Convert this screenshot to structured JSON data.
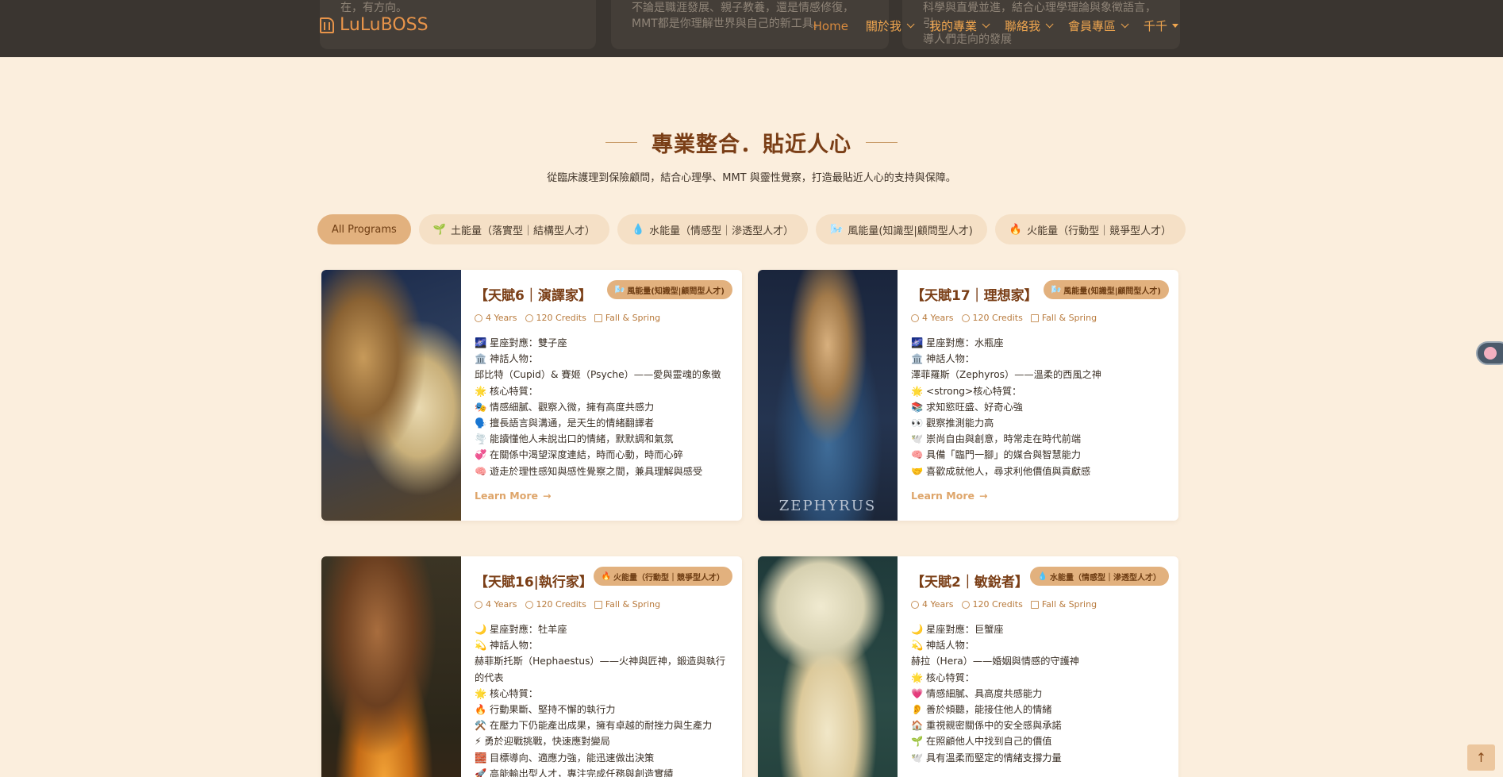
{
  "header": {
    "logo_text": "LuLuBOSS",
    "ghost_texts": [
      "在，有方向。",
      "不論是職涯發展、親子教養，還是情感修復，\nMMT都是你理解世界與自己的新工具。",
      "科學與直覺並進，結合心理學理論與象徵語言，引\n導人們走向的發展"
    ],
    "nav": [
      {
        "label": "Home"
      },
      {
        "label": "關於我"
      },
      {
        "label": "我的專業"
      },
      {
        "label": "聯絡我"
      },
      {
        "label": "會員專區"
      },
      {
        "label": "千千"
      }
    ]
  },
  "section": {
    "title": "專業整合．貼近人心",
    "subtitle": "從臨床護理到保險顧問，結合心理學、MMT 與靈性覺察，打造最貼近人心的支持與保障。"
  },
  "filters": [
    {
      "label": "All Programs",
      "icon": ""
    },
    {
      "label": "土能量（落實型｜結構型人才）",
      "icon": "🌱"
    },
    {
      "label": "水能量（情感型｜滲透型人才）",
      "icon": "💧"
    },
    {
      "label": "風能量(知識型|顧問型人才)",
      "icon": "🌬️"
    },
    {
      "label": "火能量（行動型｜競爭型人才）",
      "icon": "🔥"
    }
  ],
  "meta": {
    "years": "4 Years",
    "credits": "120 Credits",
    "term": "Fall & Spring"
  },
  "learn_more": "Learn More",
  "cards": [
    {
      "title": "【天賦6｜演譯家】",
      "tag": "風能量(知識型|顧問型人才)",
      "image_caption": "",
      "lines": [
        "🌌 星座對應：雙子座",
        "🏛️ 神話人物：",
        "邱比特（Cupid）& 賽姬（Psyche）——愛與靈魂的象徵",
        "🌟 核心特質：",
        "🎭 情感細膩、觀察入微，擁有高度共感力",
        "🗣️ 擅長語言與溝通，是天生的情緒翻譯者",
        "🌪️ 能讀懂他人未說出口的情緒，默默調和氣氛",
        "💞 在關係中渴望深度連結，時而心動，時而心碎",
        "🧠 遊走於理性感知與感性覺察之間，兼具理解與感受"
      ]
    },
    {
      "title": "【天賦17｜理想家】",
      "tag": "風能量(知識型|顧問型人才)",
      "image_caption": "ZEPHYRUS",
      "lines": [
        "🌌 星座對應：水瓶座",
        "🏛️ 神話人物：",
        "澤菲羅斯（Zephyros）——溫柔的西風之神",
        "🌟 <strong>核心特質：",
        "📚 求知慾旺盛、好奇心強",
        "👀 觀察推測能力高",
        "🕊️ 崇尚自由與創意，時常走在時代前端",
        "🧠 具備「臨門一腳」的媒合與智慧能力",
        "🤝 喜歡成就他人，尋求利他價值與貢獻感"
      ]
    },
    {
      "title": "【天賦16|執行家】",
      "tag": "火能量（行動型｜競爭型人才）",
      "image_caption": "",
      "lines": [
        "🌙 星座對應：牡羊座",
        "💫 神話人物：",
        "赫菲斯托斯（Hephaestus）——火神與匠神，鍛造與執行的代表",
        "🌟 核心特質：",
        "🔥 行動果斷、堅持不懈的執行力",
        "⚒️ 在壓力下仍能產出成果，擁有卓越的耐挫力與生產力",
        "⚡ 勇於迎戰挑戰，快速應對變局",
        "🧱 目標導向、適應力強，能迅速做出決策",
        "🚀 高能輸出型人才，專注完成任務與創造實績"
      ]
    },
    {
      "title": "【天賦2｜敏銳者】",
      "tag": "水能量（情感型｜滲透型人才）",
      "image_caption": "",
      "lines": [
        "🌙 星座對應：巨蟹座",
        "💫 神話人物：",
        "赫拉（Hera）——婚姻與情感的守護神",
        "🌟 核心特質：",
        "💗 情感細膩、具高度共感能力",
        "👂 善於傾聽，能接住他人的情緒",
        "🏠 重視親密關係中的安全感與承諾",
        "🌱 在照顧他人中找到自己的價值",
        "🕊️ 具有溫柔而堅定的情緒支撐力量"
      ]
    }
  ]
}
